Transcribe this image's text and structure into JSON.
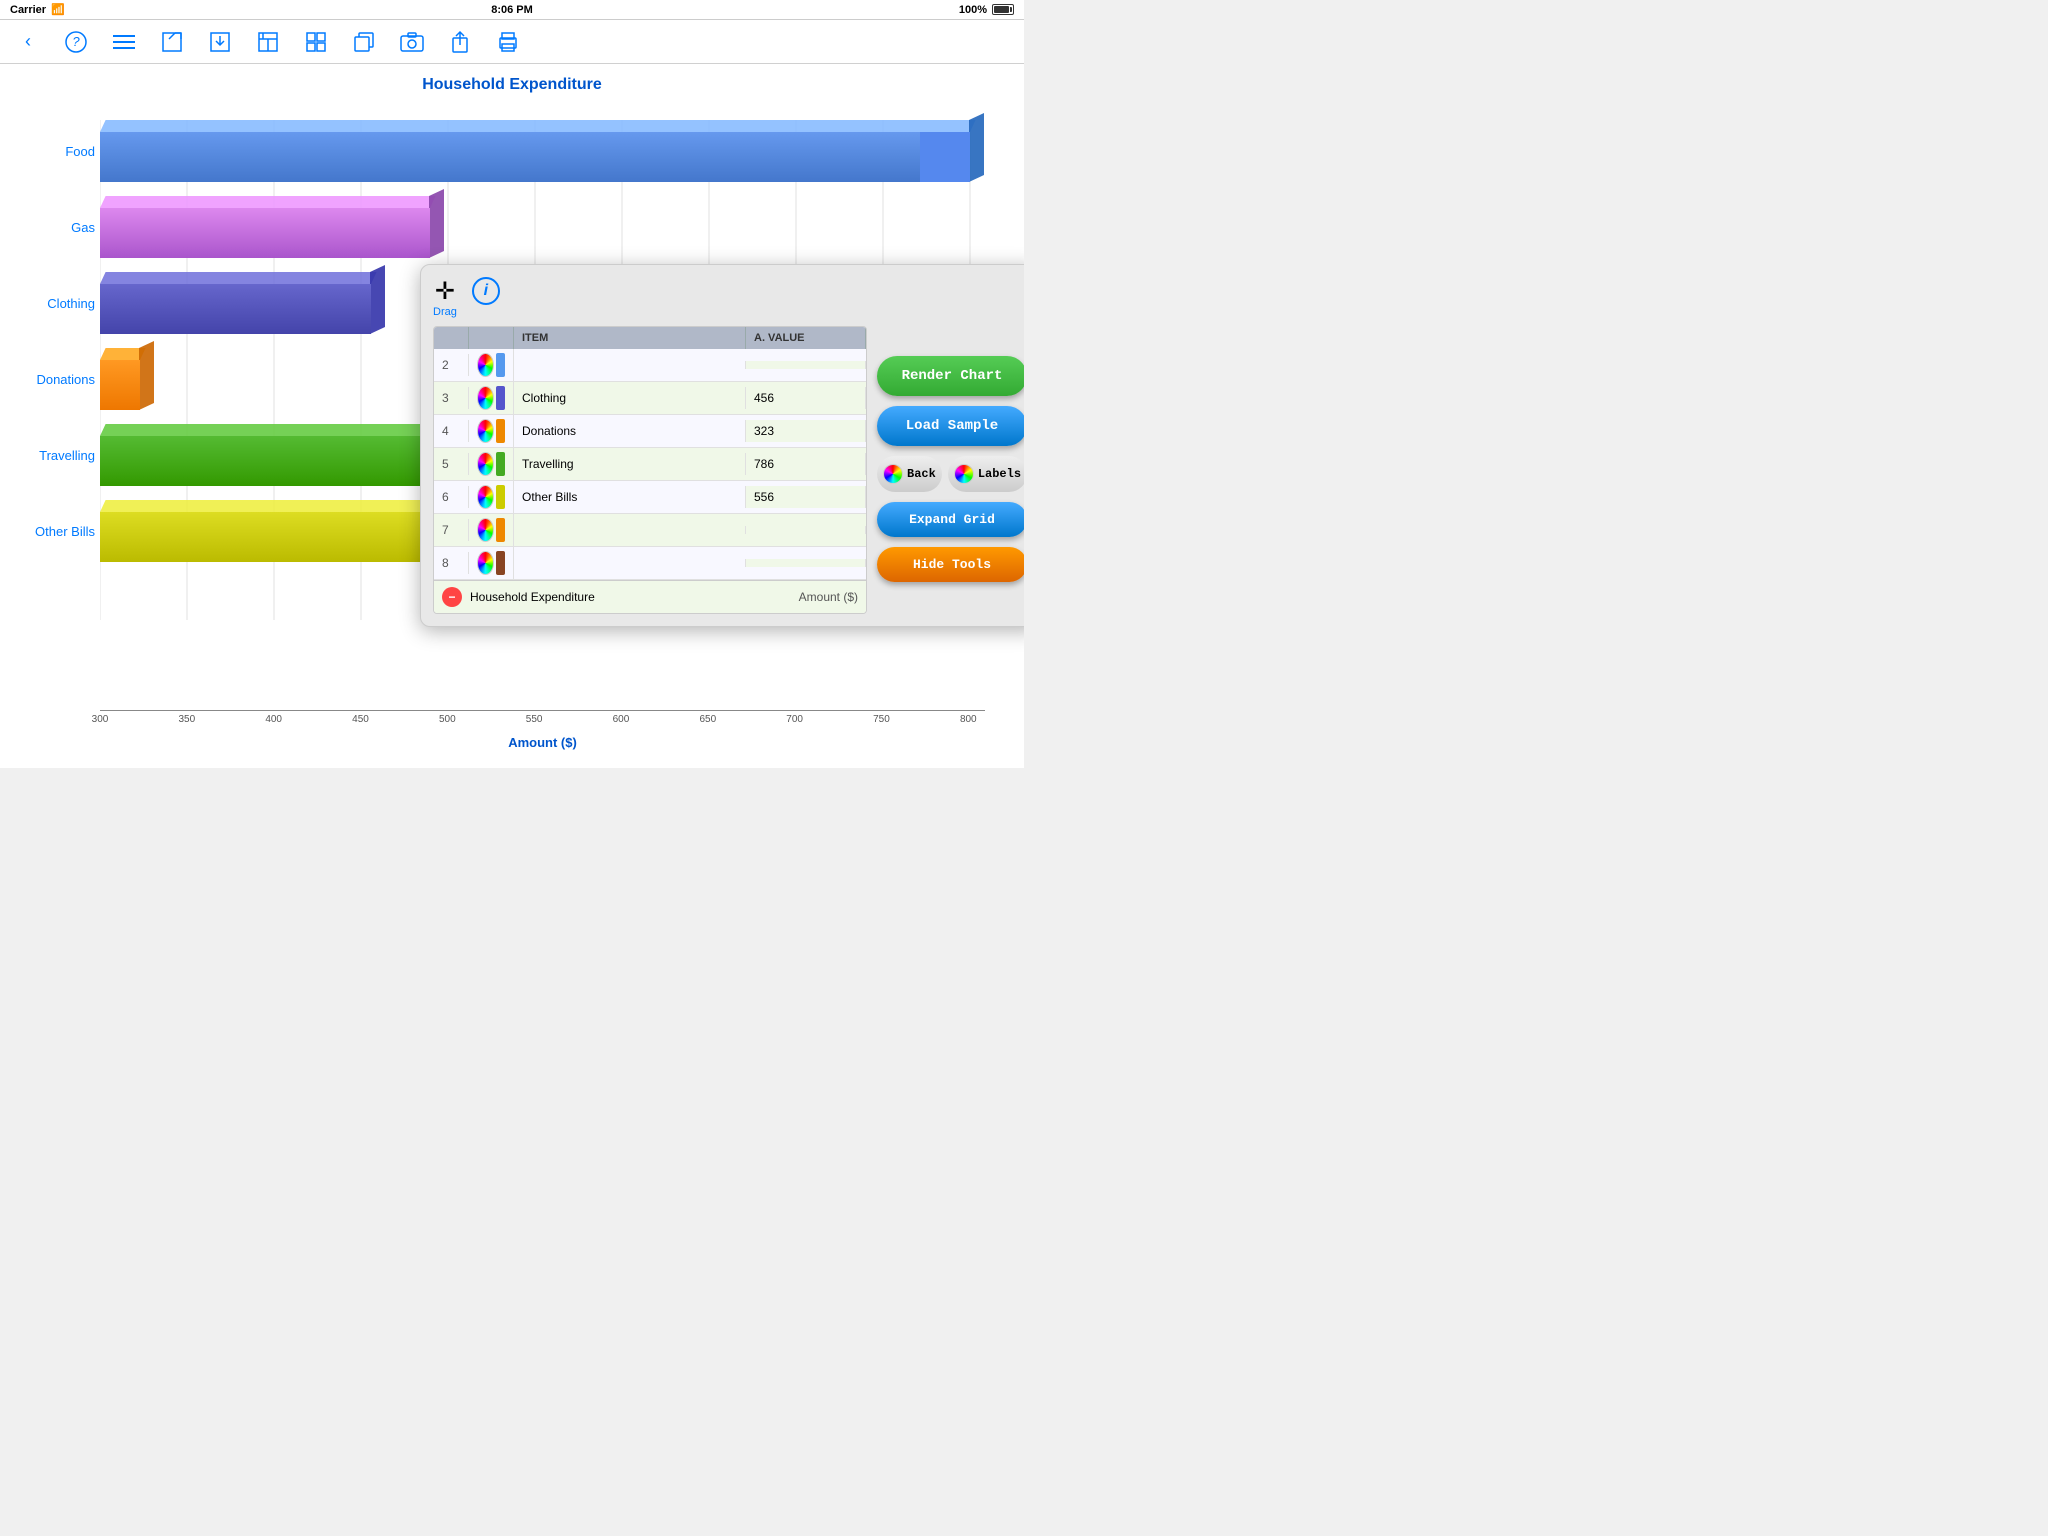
{
  "statusBar": {
    "carrier": "Carrier",
    "time": "8:06 PM",
    "battery": "100%"
  },
  "toolbar": {
    "icons": [
      "back",
      "help",
      "list",
      "edit",
      "download",
      "save",
      "grid",
      "copy",
      "camera",
      "share",
      "print"
    ]
  },
  "chart": {
    "title": "Household Expenditure",
    "xAxisTitle": "Amount ($)",
    "xAxisLabels": [
      "300",
      "350",
      "400",
      "450",
      "500",
      "550",
      "600",
      "650",
      "700",
      "750",
      "800"
    ],
    "bars": [
      {
        "label": "Food",
        "value": 800,
        "color": "#5599ee",
        "sideColor": "#2266bb",
        "topColor": "#88bbff"
      },
      {
        "label": "Gas",
        "color": "#cc77dd",
        "sideColor": "#8844aa",
        "topColor": "#ee99ff",
        "value": 490
      },
      {
        "label": "Clothing",
        "color": "#5555cc",
        "sideColor": "#3333aa",
        "topColor": "#7777dd",
        "value": 456
      },
      {
        "label": "Donations",
        "color": "#ee8800",
        "sideColor": "#cc6600",
        "topColor": "#ffaa22",
        "value": 323
      },
      {
        "label": "Travelling",
        "color": "#44aa22",
        "sideColor": "#228800",
        "topColor": "#66cc44",
        "value": 786
      },
      {
        "label": "Other Bills",
        "color": "#cccc00",
        "sideColor": "#aaaa00",
        "topColor": "#eeee44",
        "value": 556
      }
    ]
  },
  "overlay": {
    "dragLabel": "Drag",
    "columns": {
      "item": "ITEM",
      "value": "A.  VALUE"
    },
    "rows": [
      {
        "num": "2",
        "item": "",
        "value": "",
        "hasColor": true,
        "colorSwatch": "#5599ee"
      },
      {
        "num": "3",
        "item": "Clothing",
        "value": "456",
        "hasColor": true,
        "colorSwatch": "#5555cc"
      },
      {
        "num": "4",
        "item": "Donations",
        "value": "323",
        "hasColor": true,
        "colorSwatch": "#ee8800"
      },
      {
        "num": "5",
        "item": "Travelling",
        "value": "786",
        "hasColor": true,
        "colorSwatch": "#44aa22"
      },
      {
        "num": "6",
        "item": "Other Bills",
        "value": "556",
        "hasColor": true,
        "colorSwatch": "#cccc00"
      },
      {
        "num": "7",
        "item": "",
        "value": "",
        "hasColor": true,
        "colorSwatch": "#ee8800"
      },
      {
        "num": "8",
        "item": "",
        "value": "",
        "hasColor": true,
        "colorSwatch": "#884422"
      }
    ],
    "footer": {
      "chartName": "Household Expenditure",
      "axisLabel": "Amount ($)"
    }
  },
  "buttons": {
    "renderChart": "Render Chart",
    "loadSample": "Load  Sample",
    "back": "Back",
    "labels": "Labels",
    "expandGrid": "Expand Grid",
    "hideTools": "Hide Tools"
  }
}
